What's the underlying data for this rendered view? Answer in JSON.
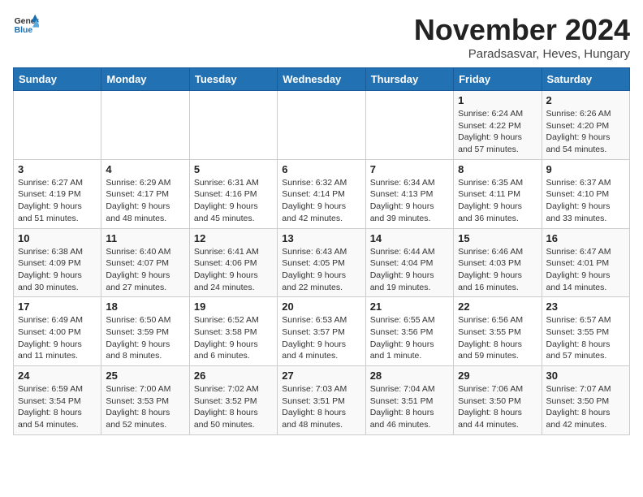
{
  "header": {
    "logo_general": "General",
    "logo_blue": "Blue",
    "month": "November 2024",
    "location": "Paradsasvar, Heves, Hungary"
  },
  "weekdays": [
    "Sunday",
    "Monday",
    "Tuesday",
    "Wednesday",
    "Thursday",
    "Friday",
    "Saturday"
  ],
  "weeks": [
    [
      {
        "day": "",
        "info": ""
      },
      {
        "day": "",
        "info": ""
      },
      {
        "day": "",
        "info": ""
      },
      {
        "day": "",
        "info": ""
      },
      {
        "day": "",
        "info": ""
      },
      {
        "day": "1",
        "info": "Sunrise: 6:24 AM\nSunset: 4:22 PM\nDaylight: 9 hours\nand 57 minutes."
      },
      {
        "day": "2",
        "info": "Sunrise: 6:26 AM\nSunset: 4:20 PM\nDaylight: 9 hours\nand 54 minutes."
      }
    ],
    [
      {
        "day": "3",
        "info": "Sunrise: 6:27 AM\nSunset: 4:19 PM\nDaylight: 9 hours\nand 51 minutes."
      },
      {
        "day": "4",
        "info": "Sunrise: 6:29 AM\nSunset: 4:17 PM\nDaylight: 9 hours\nand 48 minutes."
      },
      {
        "day": "5",
        "info": "Sunrise: 6:31 AM\nSunset: 4:16 PM\nDaylight: 9 hours\nand 45 minutes."
      },
      {
        "day": "6",
        "info": "Sunrise: 6:32 AM\nSunset: 4:14 PM\nDaylight: 9 hours\nand 42 minutes."
      },
      {
        "day": "7",
        "info": "Sunrise: 6:34 AM\nSunset: 4:13 PM\nDaylight: 9 hours\nand 39 minutes."
      },
      {
        "day": "8",
        "info": "Sunrise: 6:35 AM\nSunset: 4:11 PM\nDaylight: 9 hours\nand 36 minutes."
      },
      {
        "day": "9",
        "info": "Sunrise: 6:37 AM\nSunset: 4:10 PM\nDaylight: 9 hours\nand 33 minutes."
      }
    ],
    [
      {
        "day": "10",
        "info": "Sunrise: 6:38 AM\nSunset: 4:09 PM\nDaylight: 9 hours\nand 30 minutes."
      },
      {
        "day": "11",
        "info": "Sunrise: 6:40 AM\nSunset: 4:07 PM\nDaylight: 9 hours\nand 27 minutes."
      },
      {
        "day": "12",
        "info": "Sunrise: 6:41 AM\nSunset: 4:06 PM\nDaylight: 9 hours\nand 24 minutes."
      },
      {
        "day": "13",
        "info": "Sunrise: 6:43 AM\nSunset: 4:05 PM\nDaylight: 9 hours\nand 22 minutes."
      },
      {
        "day": "14",
        "info": "Sunrise: 6:44 AM\nSunset: 4:04 PM\nDaylight: 9 hours\nand 19 minutes."
      },
      {
        "day": "15",
        "info": "Sunrise: 6:46 AM\nSunset: 4:03 PM\nDaylight: 9 hours\nand 16 minutes."
      },
      {
        "day": "16",
        "info": "Sunrise: 6:47 AM\nSunset: 4:01 PM\nDaylight: 9 hours\nand 14 minutes."
      }
    ],
    [
      {
        "day": "17",
        "info": "Sunrise: 6:49 AM\nSunset: 4:00 PM\nDaylight: 9 hours\nand 11 minutes."
      },
      {
        "day": "18",
        "info": "Sunrise: 6:50 AM\nSunset: 3:59 PM\nDaylight: 9 hours\nand 8 minutes."
      },
      {
        "day": "19",
        "info": "Sunrise: 6:52 AM\nSunset: 3:58 PM\nDaylight: 9 hours\nand 6 minutes."
      },
      {
        "day": "20",
        "info": "Sunrise: 6:53 AM\nSunset: 3:57 PM\nDaylight: 9 hours\nand 4 minutes."
      },
      {
        "day": "21",
        "info": "Sunrise: 6:55 AM\nSunset: 3:56 PM\nDaylight: 9 hours\nand 1 minute."
      },
      {
        "day": "22",
        "info": "Sunrise: 6:56 AM\nSunset: 3:55 PM\nDaylight: 8 hours\nand 59 minutes."
      },
      {
        "day": "23",
        "info": "Sunrise: 6:57 AM\nSunset: 3:55 PM\nDaylight: 8 hours\nand 57 minutes."
      }
    ],
    [
      {
        "day": "24",
        "info": "Sunrise: 6:59 AM\nSunset: 3:54 PM\nDaylight: 8 hours\nand 54 minutes."
      },
      {
        "day": "25",
        "info": "Sunrise: 7:00 AM\nSunset: 3:53 PM\nDaylight: 8 hours\nand 52 minutes."
      },
      {
        "day": "26",
        "info": "Sunrise: 7:02 AM\nSunset: 3:52 PM\nDaylight: 8 hours\nand 50 minutes."
      },
      {
        "day": "27",
        "info": "Sunrise: 7:03 AM\nSunset: 3:51 PM\nDaylight: 8 hours\nand 48 minutes."
      },
      {
        "day": "28",
        "info": "Sunrise: 7:04 AM\nSunset: 3:51 PM\nDaylight: 8 hours\nand 46 minutes."
      },
      {
        "day": "29",
        "info": "Sunrise: 7:06 AM\nSunset: 3:50 PM\nDaylight: 8 hours\nand 44 minutes."
      },
      {
        "day": "30",
        "info": "Sunrise: 7:07 AM\nSunset: 3:50 PM\nDaylight: 8 hours\nand 42 minutes."
      }
    ]
  ]
}
